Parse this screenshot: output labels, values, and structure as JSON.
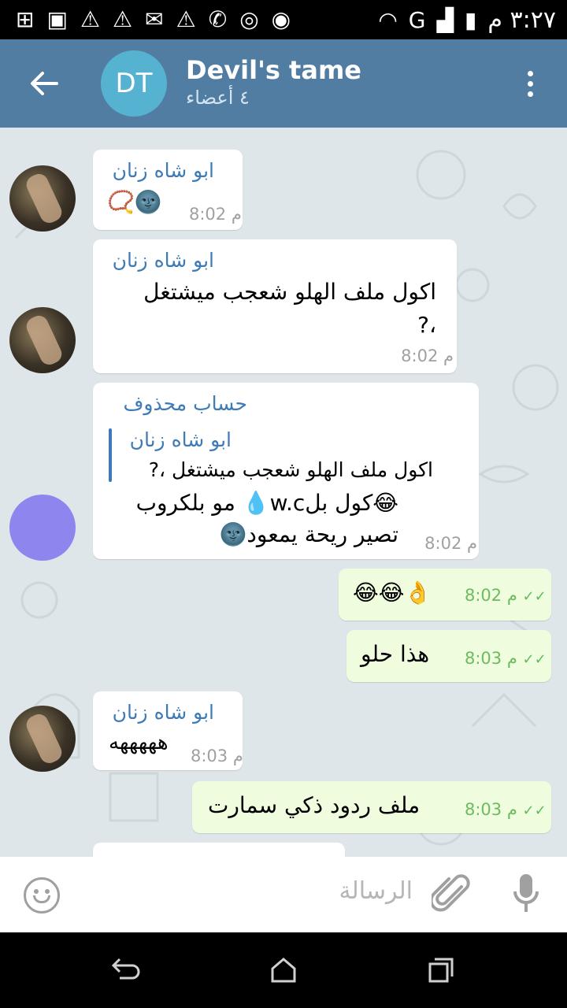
{
  "status_bar": {
    "time": "٣:٢٧ م",
    "network": "G",
    "left_icons": [
      "plus-box-icon",
      "image-icon",
      "warning-icon",
      "warning-icon",
      "mail-icon",
      "warning-icon",
      "missed-call-icon",
      "viber-icon",
      "messenger-icon"
    ]
  },
  "header": {
    "avatar_initials": "DT",
    "title": "Devil's tame",
    "subtitle": "٤ أعضاء"
  },
  "messages": [
    {
      "type": "in",
      "sender": "ابو شاه زنان",
      "text": "🌚📿",
      "time": "8:02 م"
    },
    {
      "type": "in",
      "sender": "ابو شاه زنان",
      "text_line1": "اكول ملف الهلو شعجب ميشتغل",
      "text_line2": "،?",
      "time": "8:02 م"
    },
    {
      "type": "in",
      "sender": "حساب محذوف",
      "reply_sender": "ابو شاه زنان",
      "reply_text": "اكول ملف الهلو شعجب ميشتغل ،?",
      "text_line1": "😂كول بلw.c💧 مو بلكروب",
      "text_line2": "تصير ريحة يمعود🌚",
      "time": "8:02 م"
    },
    {
      "type": "out",
      "text": "👌😂😂",
      "time": "8:02 م"
    },
    {
      "type": "out",
      "text": "هذا حلو",
      "time": "8:03 م"
    },
    {
      "type": "in",
      "sender": "ابو شاه زنان",
      "text": "هههههه",
      "time": "8:03 م"
    },
    {
      "type": "out",
      "text": "ملف ردود ذكي سمارت",
      "time": "8:03 م"
    }
  ],
  "input": {
    "placeholder": "الرسالة"
  },
  "colors": {
    "header_bg": "#517da2",
    "chat_bg": "#dfe6e9",
    "outgoing_bubble": "#effdde",
    "sender_name": "#3e7bb6",
    "read_ticks": "#5fbb5f"
  }
}
